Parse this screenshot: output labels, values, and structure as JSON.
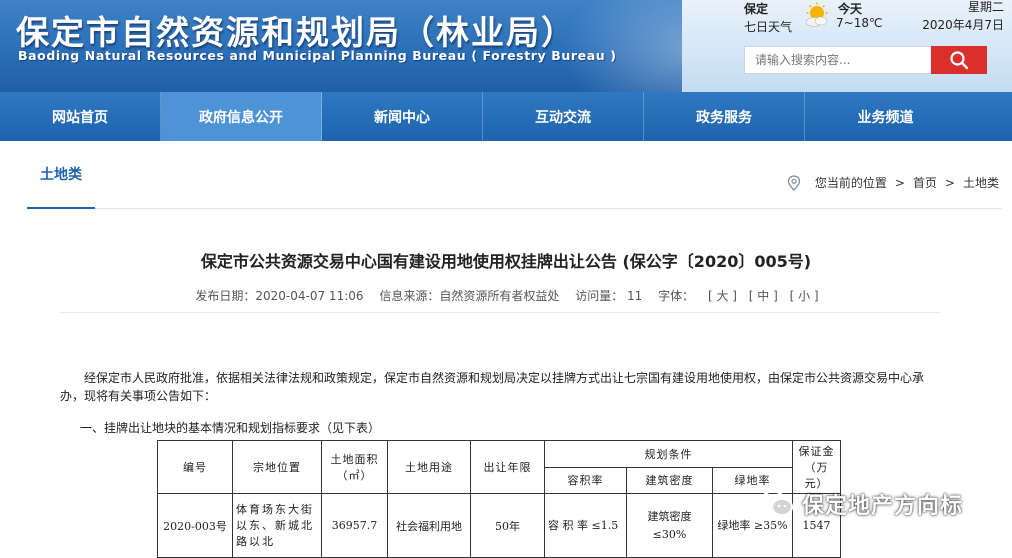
{
  "header": {
    "title_cn": "保定市自然资源和规划局（林业局）",
    "title_en": "Baoding Natural Resources and Municipal Planning Bureau  ( Forestry Bureau )"
  },
  "weather": {
    "city": "保定",
    "forecast": "七日天气",
    "today": "今天",
    "temp": "7~18℃",
    "weekday": "星期二",
    "date": "2020年4月7日",
    "icon": "sunny-cloud-icon"
  },
  "search": {
    "placeholder": "请输入搜索内容...",
    "icon": "search-icon"
  },
  "nav": {
    "items": [
      "网站首页",
      "政府信息公开",
      "新闻中心",
      "互动交流",
      "政务服务",
      "业务频道"
    ],
    "active": "政府信息公开"
  },
  "category": {
    "tab": "土地类",
    "breadcrumb": {
      "prefix": "您当前的位置",
      "home": "首页",
      "current": "土地类",
      "sep": ">"
    }
  },
  "article": {
    "title": "保定市公共资源交易中心国有建设用地使用权挂牌出让公告 (保公字〔2020〕005号)",
    "meta": {
      "date": "发布日期：2020-04-07 11:06",
      "source": "信息来源：自然资源所有者权益处",
      "views": "访问量： 11",
      "font_label": "字体：",
      "size_large": "[ 大 ]",
      "size_mid": "[ 中 ]",
      "size_small": "[ 小 ]"
    },
    "paragraph": "经保定市人民政府批准，依据相关法律法规和政策规定，保定市自然资源和规划局决定以挂牌方式出让七宗国有建设用地使用权，由保定市公共资源交易中心承办，现将有关事项公告如下：",
    "section1": "一、挂牌出让地块的基本情况和规划指标要求（见下表）"
  },
  "table": {
    "headers": {
      "no": "编号",
      "location": "宗地位置",
      "area": "土地面积（㎡）",
      "use": "土地用途",
      "term": "出让年限",
      "planning": "规划条件",
      "far": "容积率",
      "density": "建筑密度",
      "green": "绿地率",
      "deposit": "保证金（万元）"
    },
    "rows": [
      {
        "no": "2020-003号",
        "location": "体育场东大街以东、新城北路以北",
        "area": "36957.7",
        "use": "社会福利用地",
        "term": "50年",
        "far": "容 积 率 ≤1.5",
        "density": "建筑密度 ≤30%",
        "green": "绿地率 ≥35%",
        "deposit": "1547"
      }
    ]
  },
  "watermark": {
    "text": "保定地产方向标",
    "icon": "wechat-icon"
  }
}
